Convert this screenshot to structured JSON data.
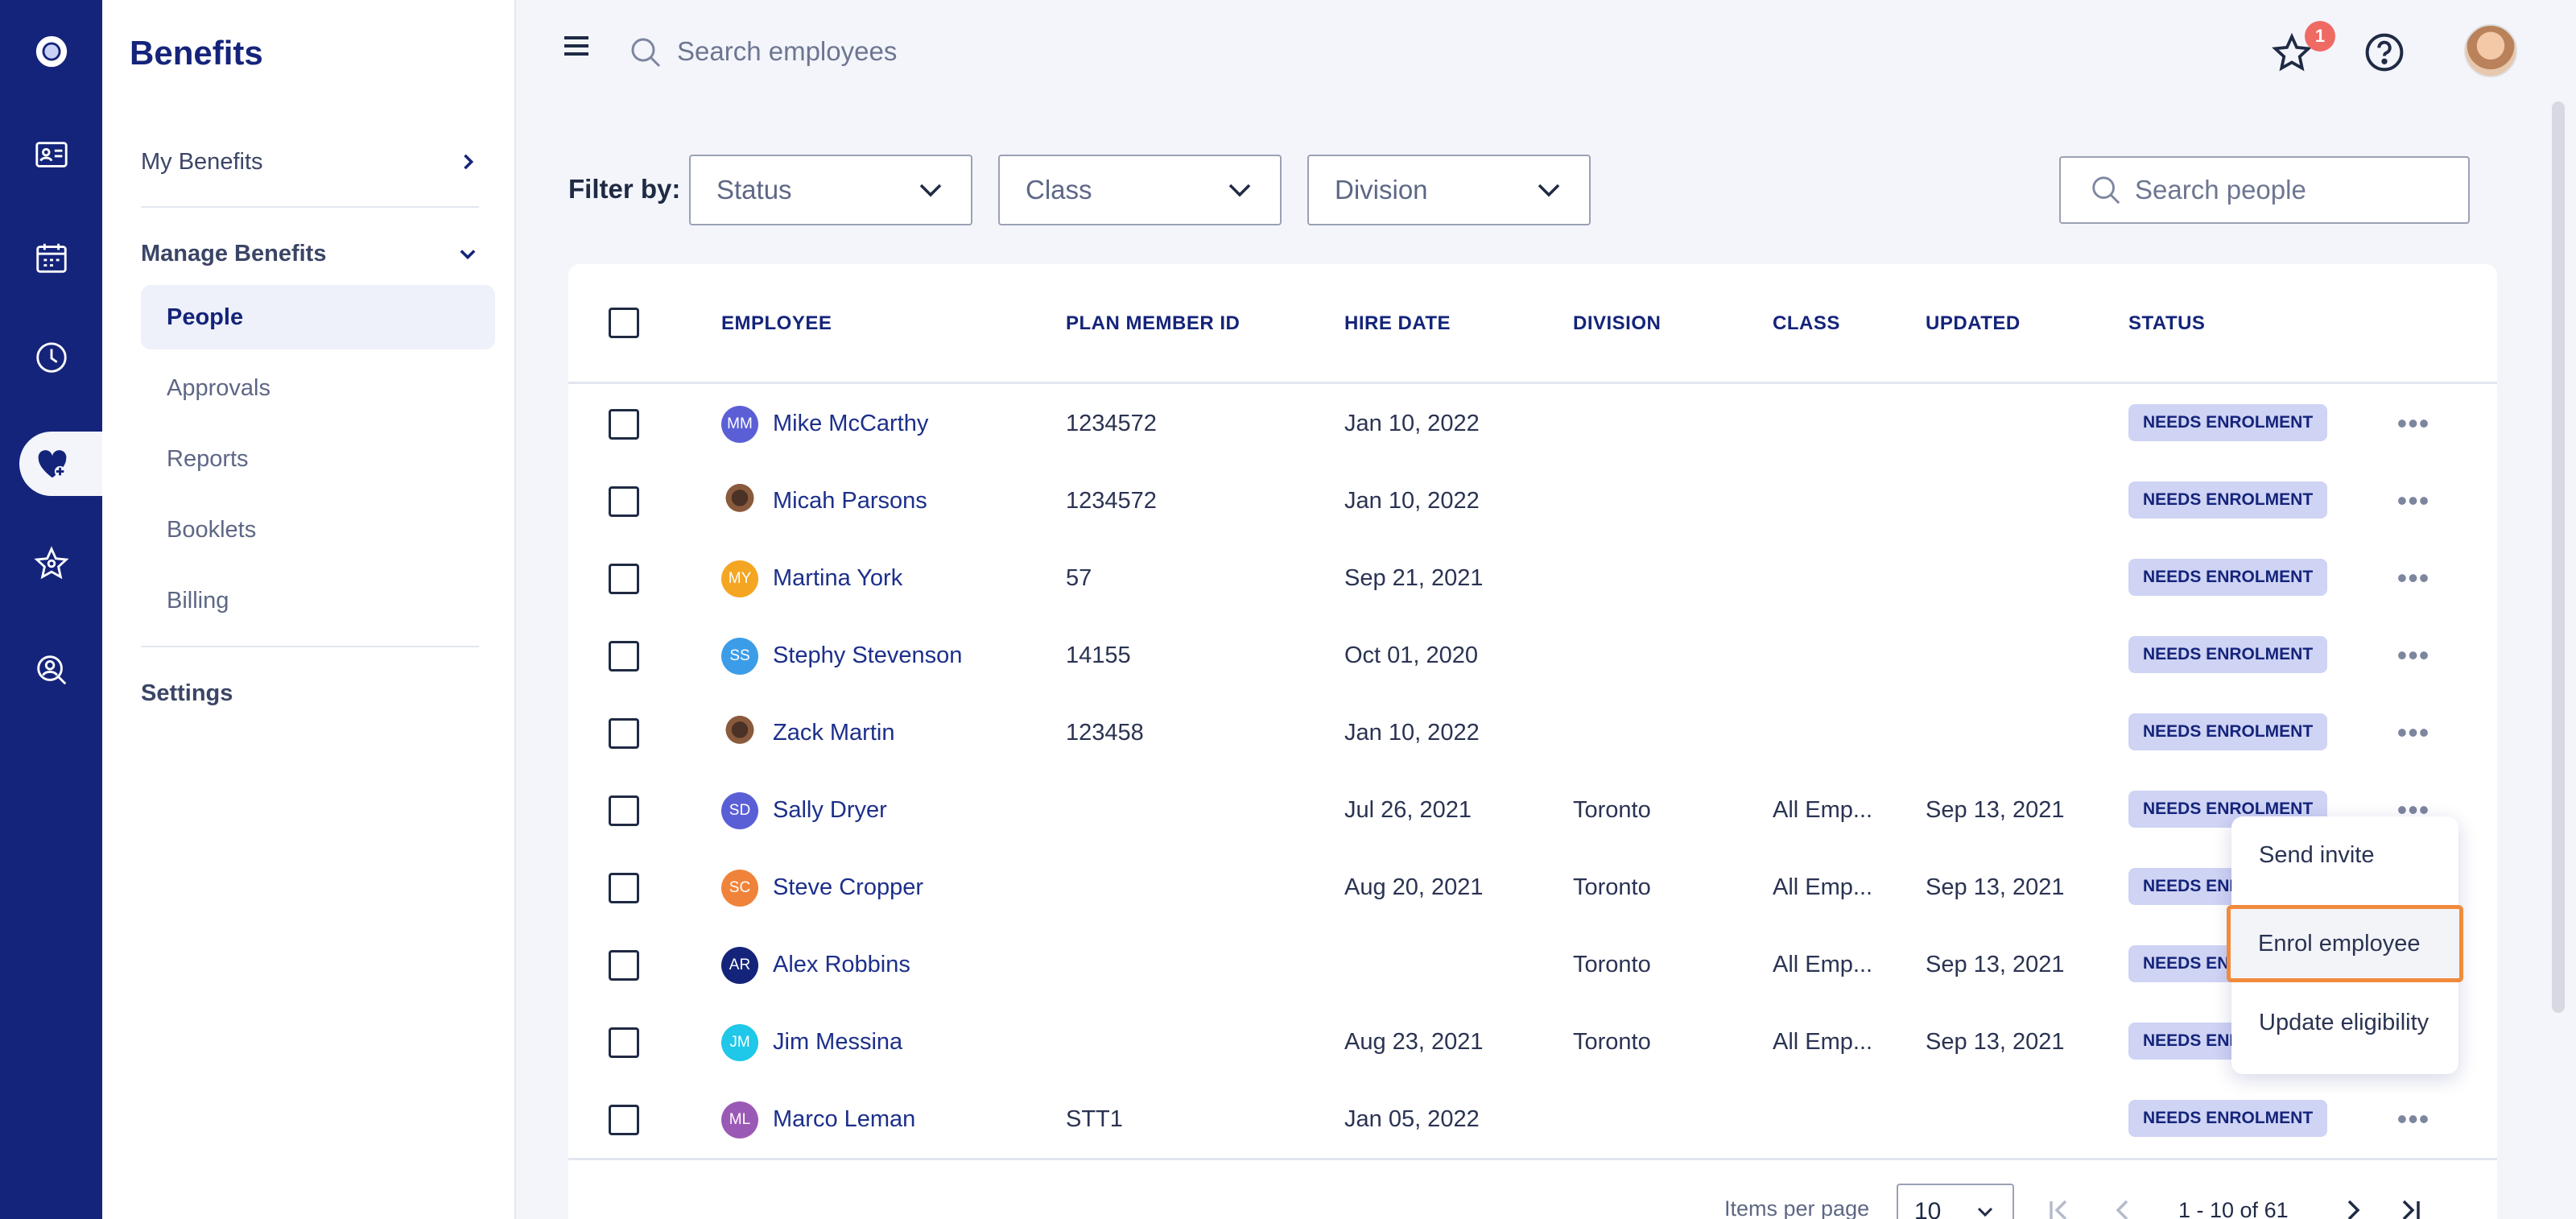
{
  "sidebar": {
    "title": "Benefits",
    "my_benefits": "My Benefits",
    "manage_benefits": "Manage Benefits",
    "items": [
      {
        "label": "People",
        "active": true
      },
      {
        "label": "Approvals"
      },
      {
        "label": "Reports"
      },
      {
        "label": "Booklets"
      },
      {
        "label": "Billing"
      }
    ],
    "settings": "Settings"
  },
  "topbar": {
    "search_placeholder": "Search employees",
    "notification_count": "1"
  },
  "filters": {
    "label": "Filter by:",
    "status": "Status",
    "class": "Class",
    "division": "Division",
    "search_placeholder": "Search people"
  },
  "table": {
    "headers": {
      "employee": "EMPLOYEE",
      "plan_member_id": "PLAN MEMBER ID",
      "hire_date": "HIRE DATE",
      "division": "DIVISION",
      "class": "CLASS",
      "updated": "UPDATED",
      "status": "STATUS"
    },
    "rows": [
      {
        "initials": "MM",
        "avatar_color": "#5b5fd6",
        "name": "Mike McCarthy",
        "plan_member_id": "1234572",
        "hire_date": "Jan 10, 2022",
        "division": "",
        "class": "",
        "updated": "",
        "status": "NEEDS ENROLMENT"
      },
      {
        "initials": "",
        "avatar_color": "photo",
        "name": "Micah Parsons",
        "plan_member_id": "1234572",
        "hire_date": "Jan 10, 2022",
        "division": "",
        "class": "",
        "updated": "",
        "status": "NEEDS ENROLMENT"
      },
      {
        "initials": "MY",
        "avatar_color": "#f4a623",
        "name": "Martina York",
        "plan_member_id": "57",
        "hire_date": "Sep 21, 2021",
        "division": "",
        "class": "",
        "updated": "",
        "status": "NEEDS ENROLMENT"
      },
      {
        "initials": "SS",
        "avatar_color": "#3b9de8",
        "name": "Stephy Stevenson",
        "plan_member_id": "14155",
        "hire_date": "Oct 01, 2020",
        "division": "",
        "class": "",
        "updated": "",
        "status": "NEEDS ENROLMENT"
      },
      {
        "initials": "",
        "avatar_color": "photo",
        "name": "Zack Martin",
        "plan_member_id": "123458",
        "hire_date": "Jan 10, 2022",
        "division": "",
        "class": "",
        "updated": "",
        "status": "NEEDS ENROLMENT"
      },
      {
        "initials": "SD",
        "avatar_color": "#5b5fd6",
        "name": "Sally Dryer",
        "plan_member_id": "",
        "hire_date": "Jul 26, 2021",
        "division": "Toronto",
        "class": "All Emp...",
        "updated": "Sep 13, 2021",
        "status": "NEEDS ENROLMENT"
      },
      {
        "initials": "SC",
        "avatar_color": "#f0833a",
        "name": "Steve Cropper",
        "plan_member_id": "",
        "hire_date": "Aug 20, 2021",
        "division": "Toronto",
        "class": "All Emp...",
        "updated": "Sep 13, 2021",
        "status": "NEEDS ENROLMENT"
      },
      {
        "initials": "AR",
        "avatar_color": "#14247a",
        "name": "Alex Robbins",
        "plan_member_id": "",
        "hire_date": "",
        "division": "Toronto",
        "class": "All Emp...",
        "updated": "Sep 13, 2021",
        "status": "NEEDS ENROLMENT"
      },
      {
        "initials": "JM",
        "avatar_color": "#1fc7e8",
        "name": "Jim Messina",
        "plan_member_id": "",
        "hire_date": "Aug 23, 2021",
        "division": "Toronto",
        "class": "All Emp...",
        "updated": "Sep 13, 2021",
        "status": "NEEDS ENROLMENT"
      },
      {
        "initials": "ML",
        "avatar_color": "#9b59b6",
        "name": "Marco Leman",
        "plan_member_id": "STT1",
        "hire_date": "Jan 05, 2022",
        "division": "",
        "class": "",
        "updated": "",
        "status": "NEEDS ENROLMENT"
      }
    ]
  },
  "pagination": {
    "items_per_page_label": "Items per page",
    "items_per_page": "10",
    "range": "1 - 10 of 61"
  },
  "context_menu": {
    "items": [
      "Send invite",
      "Enrol employee",
      "Update eligibility"
    ],
    "highlighted": "Enrol employee"
  }
}
